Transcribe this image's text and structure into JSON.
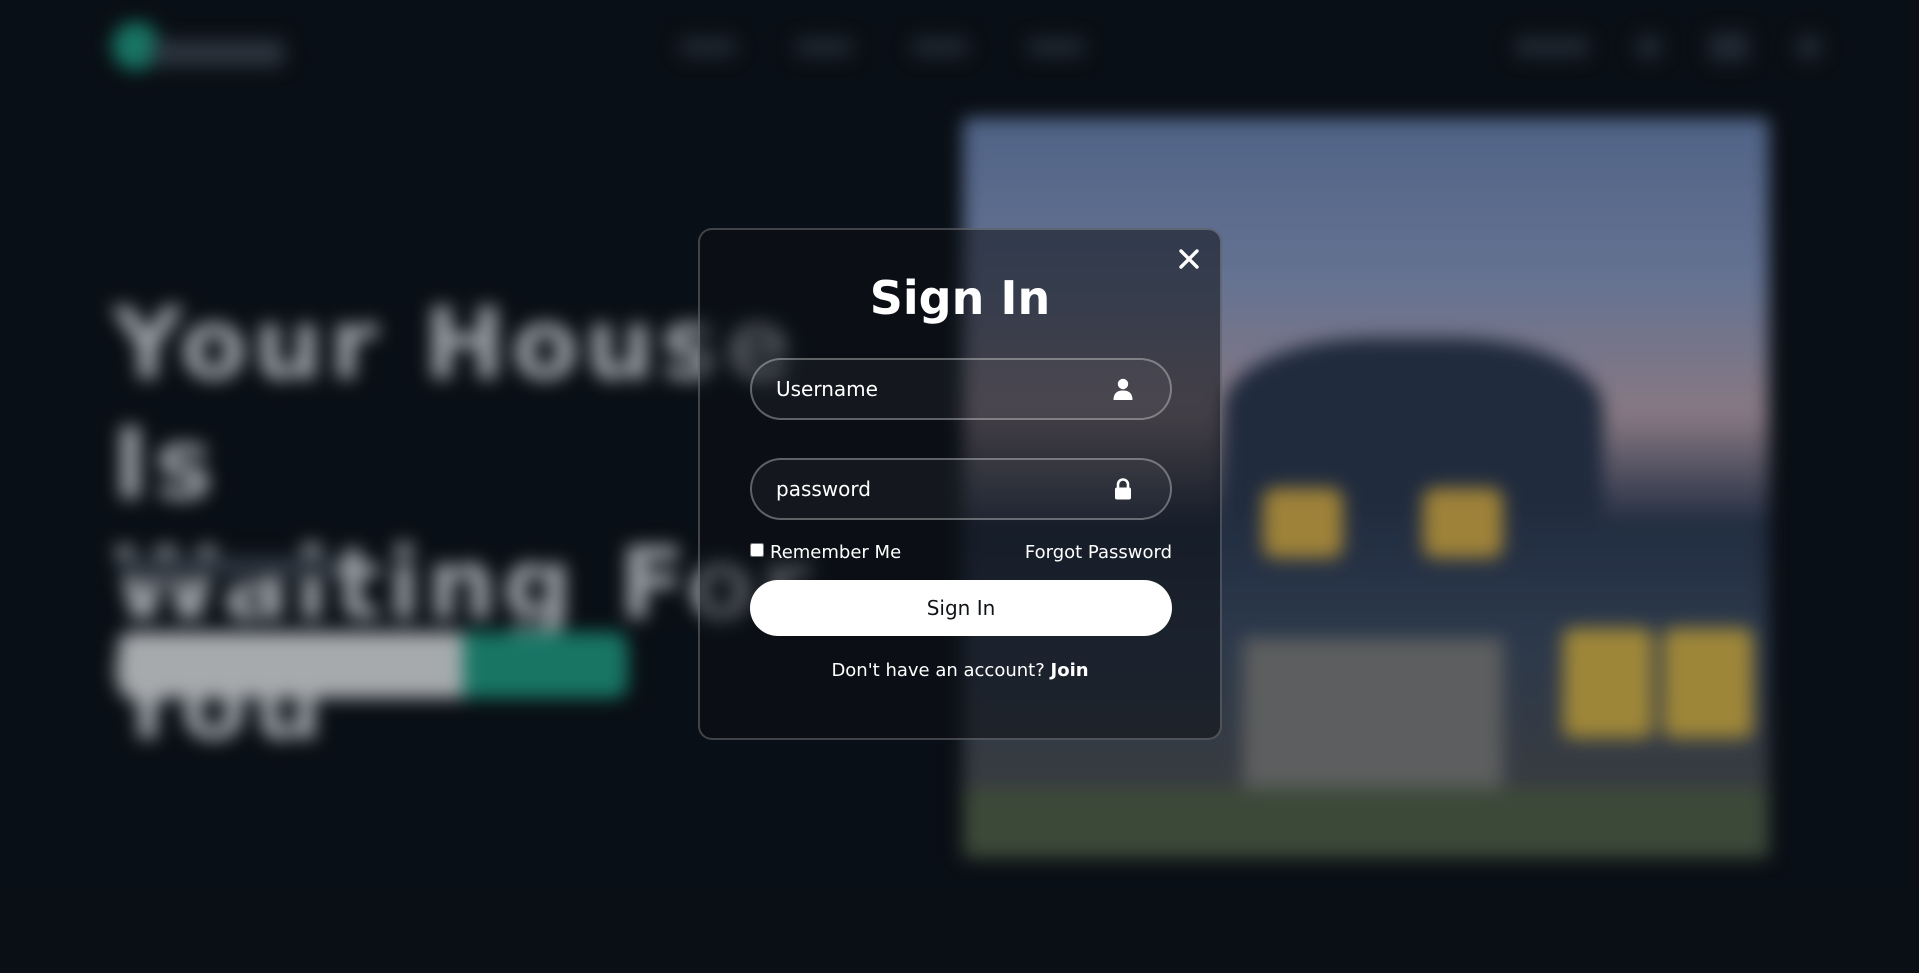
{
  "background": {
    "hero_title_line1": "Your House Is",
    "hero_title_line2": "Waiting For You"
  },
  "modal": {
    "title": "Sign In",
    "close_icon": "close-icon",
    "username": {
      "placeholder": "Username",
      "value": "",
      "icon": "user-icon"
    },
    "password": {
      "placeholder": "password",
      "value": "",
      "icon": "lock-icon"
    },
    "remember_label": "Remember Me",
    "remember_checked": false,
    "forgot_label": "Forgot Password",
    "signin_label": "Sign In",
    "no_account_text": "Don't have an account?",
    "join_label": "Join"
  },
  "colors": {
    "page_bg": "#0b1119",
    "accent": "#1f9e86",
    "modal_text": "#ffffff",
    "button_bg": "#ffffff"
  }
}
